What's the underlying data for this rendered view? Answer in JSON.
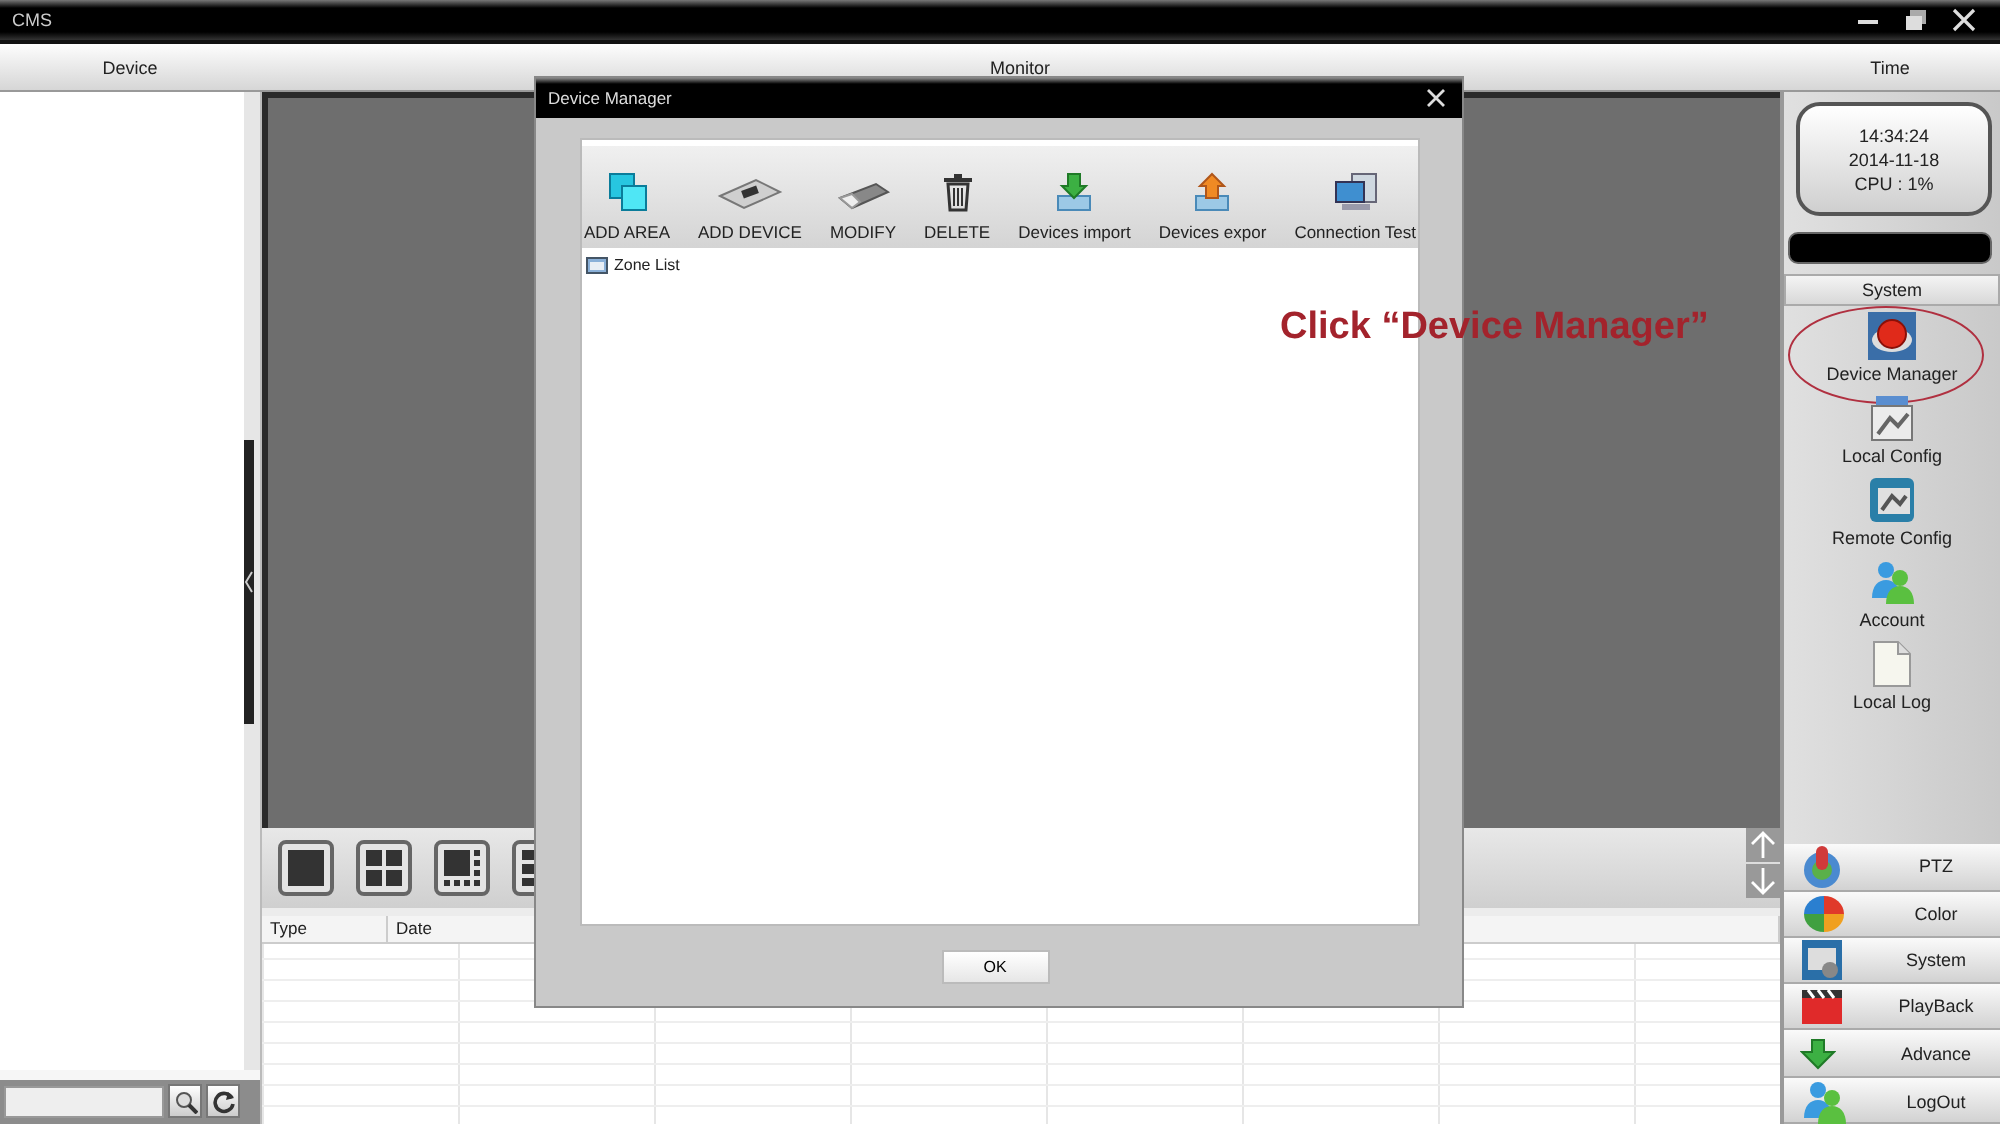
{
  "window": {
    "title": "CMS"
  },
  "header": {
    "sections": [
      {
        "label": "Device"
      },
      {
        "label": "Monitor"
      },
      {
        "label": "Time"
      }
    ]
  },
  "status": {
    "time": "14:34:24",
    "date": "2014-11-18",
    "cpu": "CPU : 1%"
  },
  "system_menu": {
    "title": "System",
    "items": [
      {
        "label": "Device Manager",
        "highlighted": true
      },
      {
        "label": "Local Config",
        "highlighted": false
      },
      {
        "label": "Remote Config",
        "highlighted": false
      },
      {
        "label": "Account",
        "highlighted": false
      },
      {
        "label": "Local Log",
        "highlighted": false
      }
    ]
  },
  "bottom_menu": {
    "items": [
      {
        "label": "PTZ"
      },
      {
        "label": "Color"
      },
      {
        "label": "System"
      },
      {
        "label": "PlayBack"
      },
      {
        "label": "Advance"
      },
      {
        "label": "LogOut"
      }
    ]
  },
  "log_table": {
    "columns": [
      "Type",
      "Date"
    ]
  },
  "dialog": {
    "title": "Device Manager",
    "toolbar": [
      {
        "label": "ADD AREA"
      },
      {
        "label": "ADD DEVICE"
      },
      {
        "label": "MODIFY"
      },
      {
        "label": "DELETE"
      },
      {
        "label": "Devices import"
      },
      {
        "label": "Devices expor"
      },
      {
        "label": "Connection Test"
      }
    ],
    "tree": [
      {
        "label": "Zone List"
      }
    ],
    "ok_button": "OK"
  },
  "annotation": {
    "text": "Click “Device Manager”"
  }
}
